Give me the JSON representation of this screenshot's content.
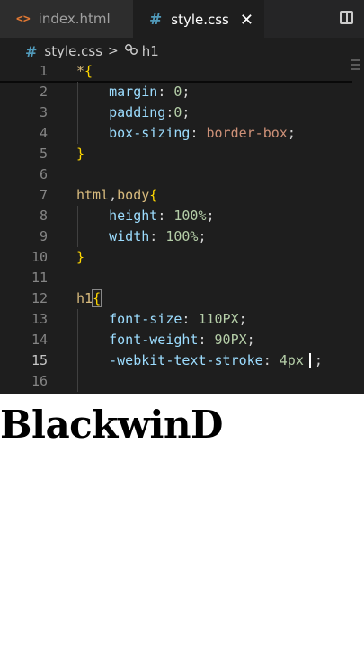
{
  "tabs": {
    "index": {
      "icon": "<>",
      "label": "index.html"
    },
    "style": {
      "icon": "#",
      "label": "style.css",
      "close": "✕"
    }
  },
  "breadcrumb": {
    "file": "style.css",
    "separator": ">",
    "symbol_icon": "symbol-class-icon",
    "symbol": "h1"
  },
  "code": {
    "lines": [
      {
        "n": "1",
        "tokens": [
          {
            "t": "*",
            "c": "sel"
          },
          {
            "t": "{",
            "c": "brace"
          }
        ]
      },
      {
        "n": "2",
        "tokens": [
          {
            "t": "    margin",
            "c": "prop"
          },
          {
            "t": ": ",
            "c": "pun"
          },
          {
            "t": "0",
            "c": "num"
          },
          {
            "t": ";",
            "c": "pun"
          }
        ]
      },
      {
        "n": "3",
        "tokens": [
          {
            "t": "    padding",
            "c": "prop"
          },
          {
            "t": ":",
            "c": "pun"
          },
          {
            "t": "0",
            "c": "num"
          },
          {
            "t": ";",
            "c": "pun"
          }
        ]
      },
      {
        "n": "4",
        "tokens": [
          {
            "t": "    box-sizing",
            "c": "prop"
          },
          {
            "t": ": ",
            "c": "pun"
          },
          {
            "t": "border-box",
            "c": "val"
          },
          {
            "t": ";",
            "c": "pun"
          }
        ]
      },
      {
        "n": "5",
        "tokens": [
          {
            "t": "}",
            "c": "brace"
          }
        ]
      },
      {
        "n": "6",
        "tokens": []
      },
      {
        "n": "7",
        "tokens": [
          {
            "t": "html",
            "c": "sel"
          },
          {
            "t": ",",
            "c": "pun"
          },
          {
            "t": "body",
            "c": "sel"
          },
          {
            "t": "{",
            "c": "brace"
          }
        ]
      },
      {
        "n": "8",
        "tokens": [
          {
            "t": "    height",
            "c": "prop"
          },
          {
            "t": ": ",
            "c": "pun"
          },
          {
            "t": "100%",
            "c": "num"
          },
          {
            "t": ";",
            "c": "pun"
          }
        ]
      },
      {
        "n": "9",
        "tokens": [
          {
            "t": "    width",
            "c": "prop"
          },
          {
            "t": ": ",
            "c": "pun"
          },
          {
            "t": "100%",
            "c": "num"
          },
          {
            "t": ";",
            "c": "pun"
          }
        ]
      },
      {
        "n": "10",
        "tokens": [
          {
            "t": "}",
            "c": "brace"
          }
        ]
      },
      {
        "n": "11",
        "tokens": []
      },
      {
        "n": "12",
        "tokens": [
          {
            "t": "h1",
            "c": "sel"
          },
          {
            "t": "{",
            "c": "brace brace-box"
          }
        ]
      },
      {
        "n": "13",
        "tokens": [
          {
            "t": "    font-size",
            "c": "prop"
          },
          {
            "t": ": ",
            "c": "pun"
          },
          {
            "t": "110PX",
            "c": "num"
          },
          {
            "t": ";",
            "c": "pun"
          }
        ]
      },
      {
        "n": "14",
        "tokens": [
          {
            "t": "    font-weight",
            "c": "prop"
          },
          {
            "t": ": ",
            "c": "pun"
          },
          {
            "t": "90PX",
            "c": "num"
          },
          {
            "t": ";",
            "c": "pun"
          }
        ]
      },
      {
        "n": "15",
        "active": true,
        "tokens": [
          {
            "t": "    -webkit-text-stroke",
            "c": "prop"
          },
          {
            "t": ": ",
            "c": "pun"
          },
          {
            "t": "4px",
            "c": "num"
          },
          {
            "t": "",
            "c": "cursor"
          },
          {
            "t": ";",
            "c": "pun"
          }
        ]
      },
      {
        "n": "16",
        "tokens": []
      }
    ]
  },
  "preview": {
    "heading": "BlackwinD"
  },
  "colors": {
    "editor_bg": "#1e1e1e",
    "tab_bar": "#252526",
    "css_icon": "#519aba",
    "html_icon": "#e37933"
  }
}
